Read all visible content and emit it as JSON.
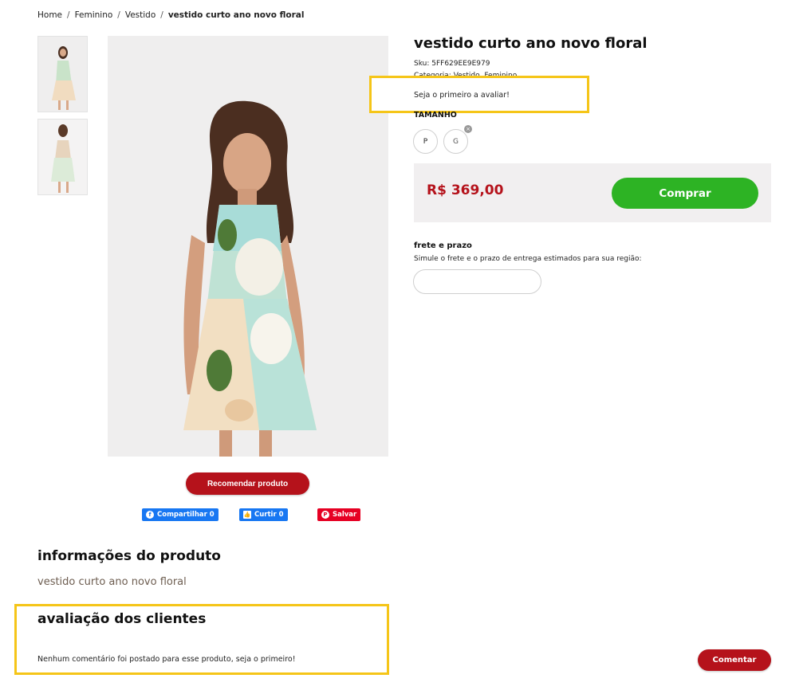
{
  "breadcrumb": {
    "items": [
      "Home",
      "Feminino",
      "Vestido"
    ],
    "current": "vestido curto ano novo floral",
    "separator": "/"
  },
  "product": {
    "title": "vestido curto ano novo floral",
    "sku": "Sku: 5FF629EE9E979",
    "category": "Categoria: Vestido, Feminino",
    "rating_prompt": "Seja o primeiro a avaliar!",
    "size_label": "TAMANHO",
    "sizes": [
      {
        "label": "P",
        "available": true
      },
      {
        "label": "G",
        "available": false
      }
    ],
    "unavailable_mark": "×",
    "price": "R$ 369,00",
    "buy_label": "Comprar"
  },
  "shipping": {
    "title": "frete e prazo",
    "description": "Simule o frete e o prazo de entrega estimados para sua região:",
    "input_value": ""
  },
  "gallery": {
    "thumbnails": [
      "front-view",
      "back-view"
    ],
    "recommend_label": "Recomendar produto"
  },
  "social": {
    "share_label": "Compartilhar 0",
    "like_label": "Curtir 0",
    "save_label": "Salvar",
    "share_icon": "f",
    "like_icon": "👍",
    "save_icon": "P"
  },
  "info": {
    "heading": "informações do produto",
    "text": "vestido curto ano novo floral"
  },
  "reviews": {
    "heading": "avaliação dos clientes",
    "empty_text": "Nenhum comentário foi postado para esse produto, seja o primeiro!",
    "comment_label": "Comentar"
  },
  "colors": {
    "brand_red": "#b5121b",
    "buy_green": "#2db324",
    "highlight_yellow": "#f5c518",
    "facebook_blue": "#1877f2",
    "pinterest_red": "#e60023"
  }
}
